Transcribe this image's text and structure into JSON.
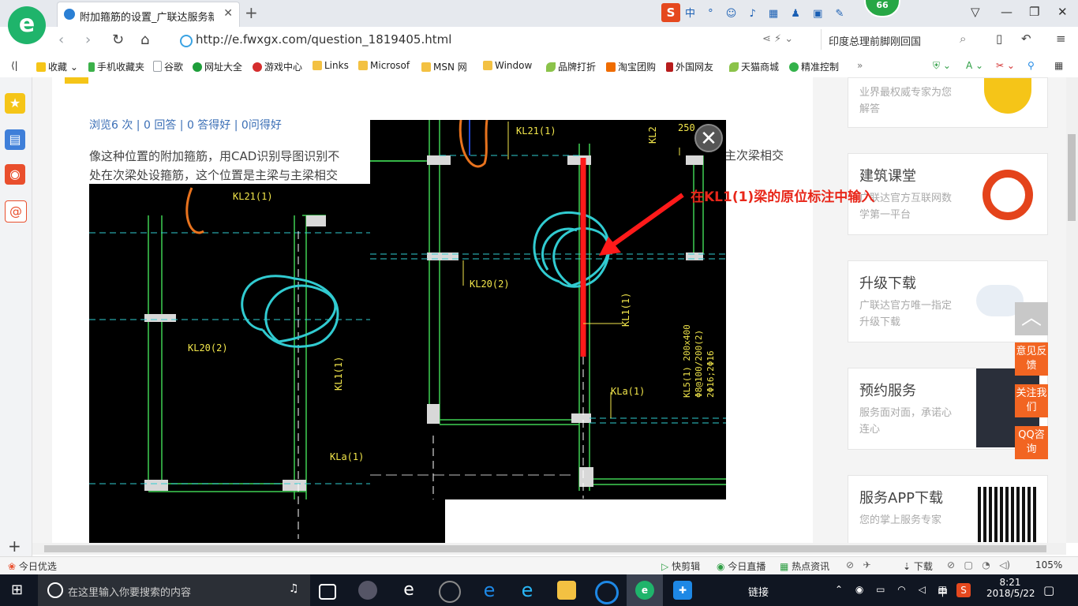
{
  "browser": {
    "tab_title": "附加箍筋的设置_广联达服务新干",
    "url": "http://e.fwxgx.com/question_1819405.html",
    "search_text": "印度总理前脚刚回国",
    "badge": "66",
    "ime_logo": "S",
    "ime_mode": "中"
  },
  "bookmarks": [
    {
      "label": "收藏",
      "icon": "star-icon",
      "color": "#f5c518"
    },
    {
      "label": "手机收藏夹",
      "icon": "phone-icon",
      "color": "#3cb14a"
    },
    {
      "label": "谷歌",
      "icon": "doc-icon",
      "color": "#9aa0a6"
    },
    {
      "label": "网址大全",
      "icon": "globe-icon",
      "color": "#1e9e3a"
    },
    {
      "label": "游戏中心",
      "icon": "game-icon",
      "color": "#d52d2d"
    },
    {
      "label": "Links",
      "icon": "folder-icon",
      "color": "#f3c142"
    },
    {
      "label": "Microsof",
      "icon": "folder-icon",
      "color": "#f3c142"
    },
    {
      "label": "MSN 网",
      "icon": "folder-icon",
      "color": "#f3c142"
    },
    {
      "label": "Window",
      "icon": "folder-icon",
      "color": "#f3c142"
    },
    {
      "label": "品牌打折",
      "icon": "leaf-icon",
      "color": "#8bc34a"
    },
    {
      "label": "淘宝团购",
      "icon": "taobao-icon",
      "color": "#ef6c00"
    },
    {
      "label": "外国网友",
      "icon": "n-icon",
      "color": "#b71c1c"
    },
    {
      "label": "天猫商城",
      "icon": "leaf-icon",
      "color": "#8bc34a"
    },
    {
      "label": "精准控制",
      "icon": "chat-icon",
      "color": "#33b24a"
    }
  ],
  "page": {
    "stats": "浏览6 次 | 0 回答 | 0 答得好 | 0问得好",
    "question_line1": "像这种位置的附加箍筋，用CAD识别导图识别不",
    "question_line1_tail": "主次梁相交",
    "question_line2": "处在次梁处设箍筋，这个位置是主梁与主梁相交",
    "cad_labels_bg": [
      "KL21(1)",
      "KL20(2)",
      "KL1(1)",
      "KLa(1)"
    ]
  },
  "popup": {
    "annotation": "在KL1(1)梁的原位标注中输入",
    "cad_labels": [
      "KL21(1)",
      "KL2",
      "250",
      "KL20(2)",
      "KL1(1)",
      "KLa(1)",
      "KL5(1) 200x400",
      "Φ8@100/200(2)",
      "2Φ16;2Φ16"
    ],
    "close_label": "✕"
  },
  "sidebar_cards": [
    {
      "title": "",
      "desc": "业界最权威专家为您解答"
    },
    {
      "title": "建筑课堂",
      "desc": "广联达官方互联网数学第一平台"
    },
    {
      "title": "升级下载",
      "desc": "广联达官方唯一指定升级下载"
    },
    {
      "title": "预约服务",
      "desc": "服务面对面，承诺心连心"
    },
    {
      "title": "服务APP下载",
      "desc": "您的掌上服务专家"
    }
  ],
  "float_buttons": {
    "feedback": "意见反馈",
    "follow": "关注我们",
    "qq": "QQ咨询"
  },
  "statusbar": {
    "left": "今日优选",
    "items": [
      "快剪辑",
      "今日直播",
      "热点资讯",
      "下载"
    ],
    "zoom": "105%"
  },
  "taskbar": {
    "search_placeholder": "在这里输入你要搜索的内容",
    "link_label": "链接",
    "ime": "中",
    "time": "8:21",
    "date": "2018/5/22"
  }
}
